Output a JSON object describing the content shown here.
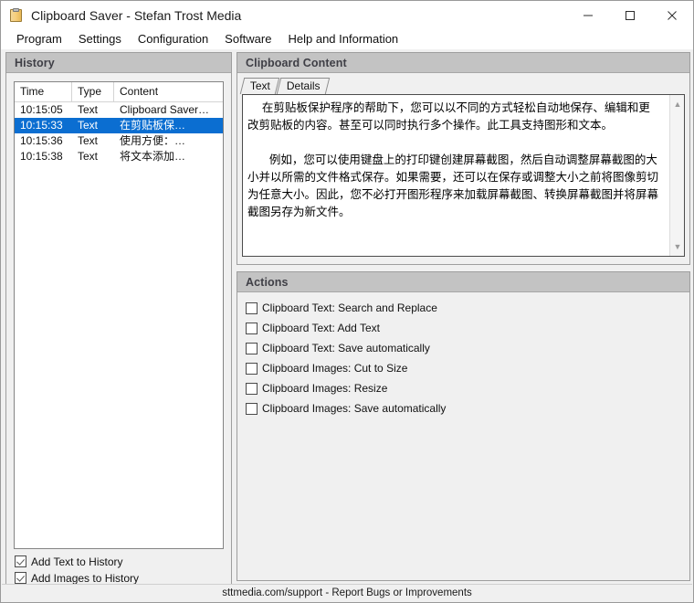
{
  "window": {
    "title": "Clipboard Saver - Stefan Trost Media",
    "icon": "clipboard-icon",
    "controls": {
      "minimize": "minimize-icon",
      "maximize": "maximize-icon",
      "close": "close-icon"
    }
  },
  "menubar": {
    "items": [
      {
        "label": "Program"
      },
      {
        "label": "Settings"
      },
      {
        "label": "Configuration"
      },
      {
        "label": "Software"
      },
      {
        "label": "Help and Information"
      }
    ]
  },
  "history": {
    "title": "History",
    "columns": [
      "Time",
      "Type",
      "Content"
    ],
    "rows": [
      {
        "time": "10:15:05",
        "type": "Text",
        "content": "Clipboard Saver…",
        "selected": false,
        "ltr": true
      },
      {
        "time": "10:15:33",
        "type": "Text",
        "content": "在剪贴板保…",
        "selected": true,
        "ltr": false
      },
      {
        "time": "10:15:36",
        "type": "Text",
        "content": "使用方便：…",
        "selected": false,
        "ltr": false
      },
      {
        "time": "10:15:38",
        "type": "Text",
        "content": "将文本添加…",
        "selected": false,
        "ltr": false
      }
    ],
    "options": [
      {
        "label": "Add Text to History",
        "checked": true
      },
      {
        "label": "Add Images to History",
        "checked": true
      }
    ]
  },
  "clipboard_content": {
    "title": "Clipboard Content",
    "tabs": [
      {
        "label": "Text",
        "active": true
      },
      {
        "label": "Details",
        "active": false
      }
    ],
    "text": "    在剪贴板保护程序的帮助下，您可以以不同的方式轻松自动地保存、编辑和更改剪贴板的内容。甚至可以同时执行多个操作。此工具支持图形和文本。\n\n      例如，您可以使用键盘上的打印键创建屏幕截图，然后自动调整屏幕截图的大小并以所需的文件格式保存。如果需要，还可以在保存或调整大小之前将图像剪切为任意大小。因此，您不必打开图形程序来加载屏幕截图、转换屏幕截图并将屏幕截图另存为新文件。",
    "scrollbar": {
      "up": "chevron-up-icon",
      "down": "chevron-down-icon"
    }
  },
  "actions": {
    "title": "Actions",
    "items": [
      {
        "label": "Clipboard Text: Search and Replace",
        "checked": false
      },
      {
        "label": "Clipboard Text: Add Text",
        "checked": false
      },
      {
        "label": "Clipboard Text: Save automatically",
        "checked": false
      },
      {
        "label": "Clipboard Images: Cut to Size",
        "checked": false
      },
      {
        "label": "Clipboard Images: Resize",
        "checked": false
      },
      {
        "label": "Clipboard Images: Save automatically",
        "checked": false
      }
    ]
  },
  "statusbar": {
    "text": "sttmedia.com/support - Report Bugs or Improvements"
  },
  "colors": {
    "selection": "#0b6ed1",
    "panel_header": "#c3c3c3",
    "window_background": "#f0f0f0",
    "header_text": "#3f3f46"
  }
}
